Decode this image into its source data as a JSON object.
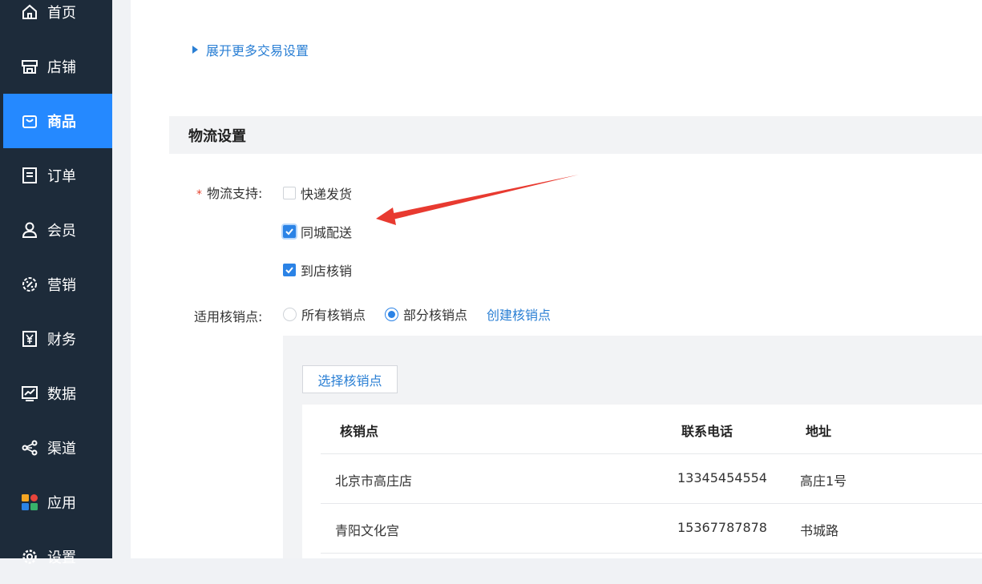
{
  "sidebar": {
    "items": [
      {
        "label": "首页",
        "icon": "home-icon"
      },
      {
        "label": "店铺",
        "icon": "store-icon"
      },
      {
        "label": "商品",
        "icon": "shopping-bag-icon",
        "active": true
      },
      {
        "label": "订单",
        "icon": "order-icon"
      },
      {
        "label": "会员",
        "icon": "user-icon"
      },
      {
        "label": "营销",
        "icon": "marketing-icon"
      },
      {
        "label": "财务",
        "icon": "yen-icon"
      },
      {
        "label": "数据",
        "icon": "chart-icon"
      },
      {
        "label": "渠道",
        "icon": "share-icon"
      },
      {
        "label": "应用",
        "icon": "apps-icon"
      },
      {
        "label": "设置",
        "icon": "settings-icon"
      }
    ]
  },
  "main": {
    "expand_link": "展开更多交易设置",
    "section_title": "物流设置",
    "logistics": {
      "label": "物流支持:",
      "options": [
        {
          "label": "快递发货",
          "checked": false
        },
        {
          "label": "同城配送",
          "checked": true
        },
        {
          "label": "到店核销",
          "checked": true
        }
      ]
    },
    "verify_points": {
      "label": "适用核销点:",
      "options": [
        {
          "label": "所有核销点",
          "selected": false
        },
        {
          "label": "部分核销点",
          "selected": true
        }
      ],
      "create_link": "创建核销点",
      "select_button": "选择核销点",
      "table": {
        "headers": [
          "核销点",
          "联系电话",
          "地址"
        ],
        "rows": [
          [
            "北京市高庄店",
            "13345454554",
            "高庄1号"
          ],
          [
            "青阳文化宫",
            "15367787878",
            "书城路"
          ]
        ]
      }
    }
  },
  "colors": {
    "sidebar_bg": "#1d2b3a",
    "active_nav": "#2589ff",
    "link": "#2a7fd4",
    "annotation_arrow": "#e83a30"
  }
}
